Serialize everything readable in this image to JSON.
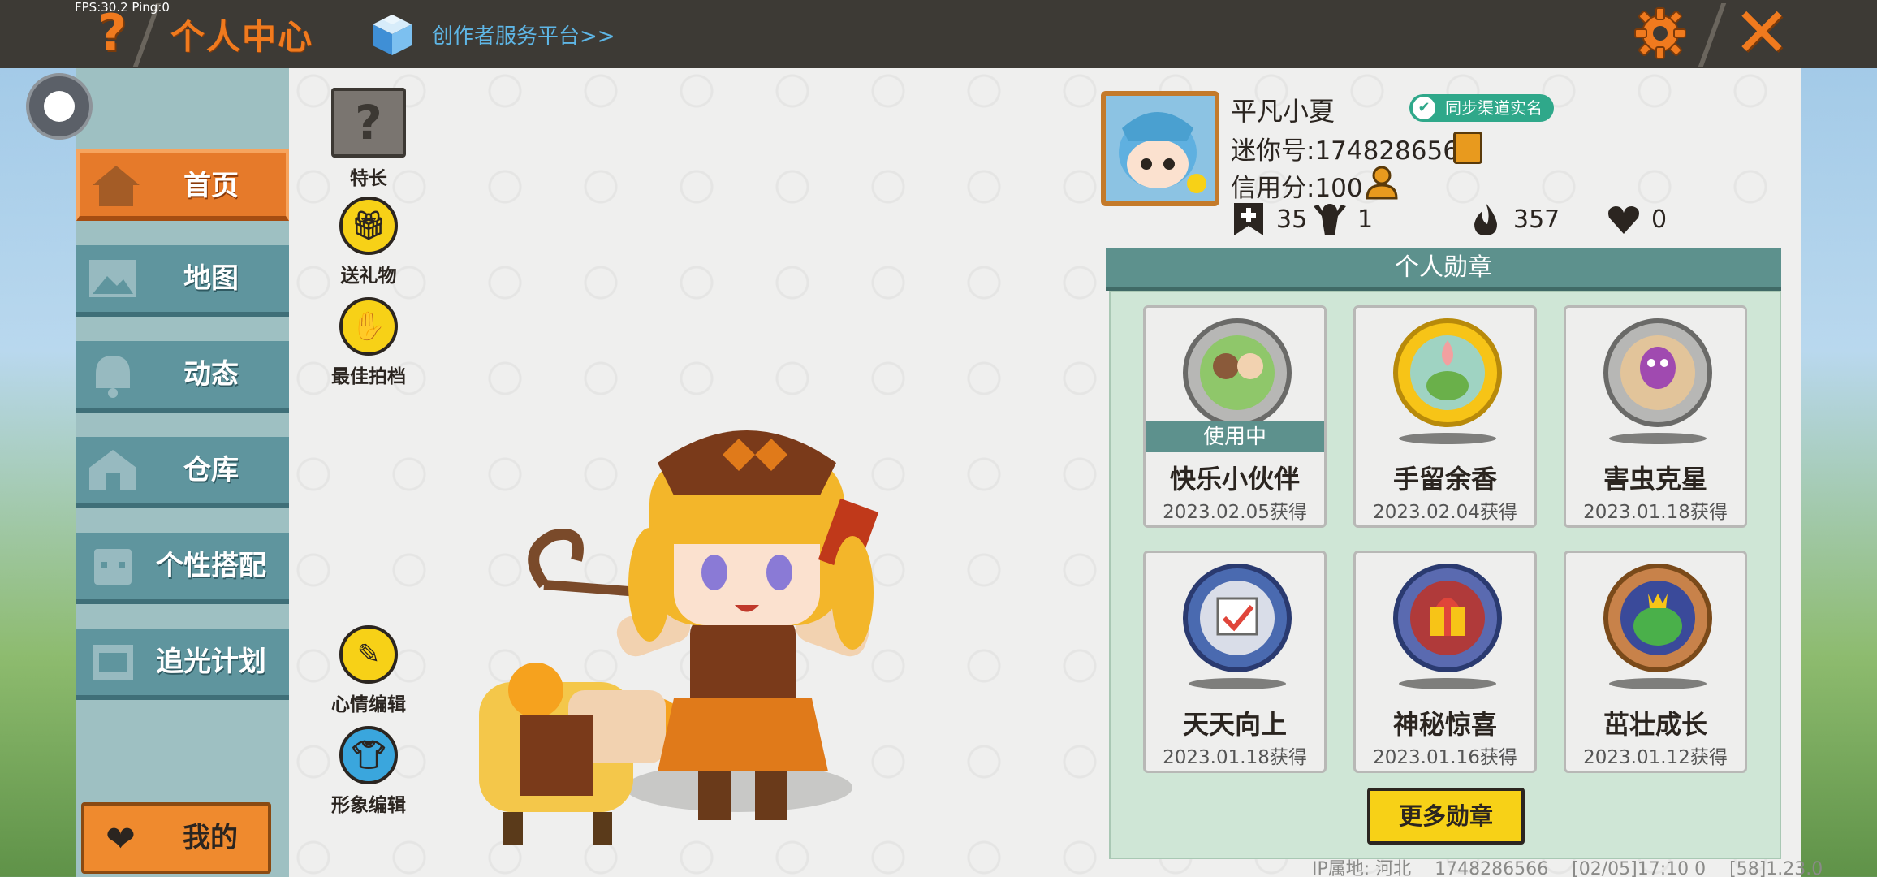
{
  "hud": {
    "fps_text": "FPS:30.2  Ping:0"
  },
  "header": {
    "title": "个人中心",
    "creator_link": "创作者服务平台>>"
  },
  "sidebar": {
    "items": [
      {
        "label": "首页",
        "active": true
      },
      {
        "label": "地图",
        "active": false
      },
      {
        "label": "动态",
        "active": false
      },
      {
        "label": "仓库",
        "active": false
      },
      {
        "label": "个性搭配",
        "active": false
      },
      {
        "label": "追光计划",
        "active": false
      }
    ],
    "mine_label": "我的"
  },
  "actions": {
    "specialty": "特长",
    "send_gift": "送礼物",
    "best_partner": "最佳拍档",
    "mood_edit": "心情编辑",
    "avatar_edit": "形象编辑"
  },
  "profile": {
    "name": "平凡小夏",
    "realname_label": "同步渠道实名",
    "mini_id": "迷你号:1748286566",
    "credit": "信用分:100",
    "stats": {
      "likes": "35",
      "fans": "1",
      "popularity": "357",
      "hearts": "0"
    }
  },
  "badges": {
    "title": "个人勋章",
    "items": [
      {
        "name": "快乐小伙伴",
        "date": "2023.02.05获得",
        "status": "使用中"
      },
      {
        "name": "手留余香",
        "date": "2023.02.04获得",
        "status": ""
      },
      {
        "name": "害虫克星",
        "date": "2023.01.18获得",
        "status": ""
      },
      {
        "name": "天天向上",
        "date": "2023.01.18获得",
        "status": ""
      },
      {
        "name": "神秘惊喜",
        "date": "2023.01.16获得",
        "status": ""
      },
      {
        "name": "茁壮成长",
        "date": "2023.01.12获得",
        "status": ""
      }
    ],
    "more_label": "更多勋章"
  },
  "footer": {
    "ip": "IP属地: 河北",
    "uid": "1748286566",
    "time": "[02/05]17:10 0",
    "version": "[58]1.23.0"
  },
  "colors": {
    "accent": "#f07a1e",
    "teal": "#5d918d",
    "yellow": "#f7d117"
  }
}
